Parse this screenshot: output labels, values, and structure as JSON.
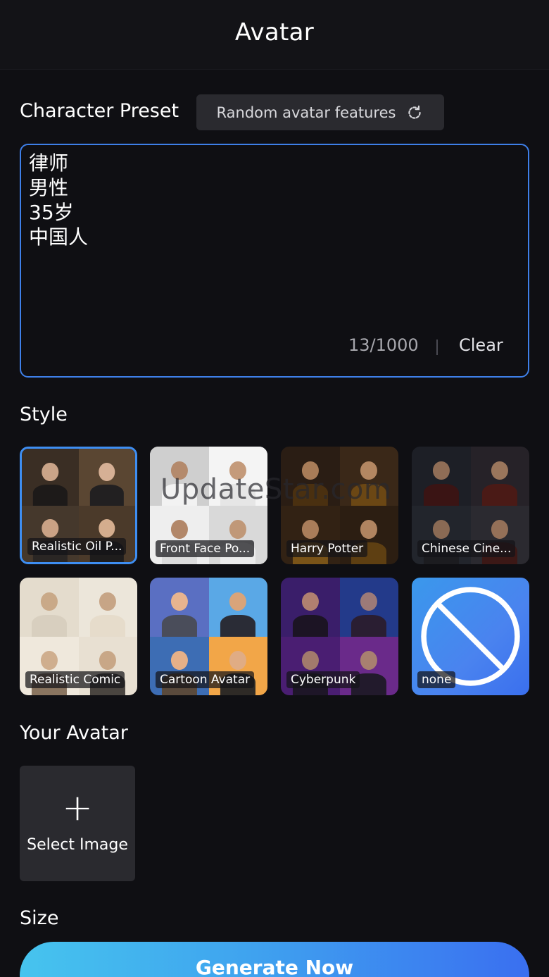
{
  "header": {
    "title": "Avatar"
  },
  "character_preset": {
    "label": "Character Preset",
    "random_button_label": "Random avatar features",
    "text": "律师\n男性\n35岁\n中国人",
    "counter": "13/1000",
    "clear_label": "Clear"
  },
  "style": {
    "label": "Style",
    "items": [
      {
        "label": "Realistic Oil P...",
        "selected": true
      },
      {
        "label": "Front Face Po..."
      },
      {
        "label": "Harry Potter"
      },
      {
        "label": "Chinese Cine..."
      },
      {
        "label": "Realistic Comic"
      },
      {
        "label": "Cartoon Avatar"
      },
      {
        "label": "Cyberpunk"
      },
      {
        "label": "none"
      }
    ]
  },
  "your_avatar": {
    "label": "Your Avatar",
    "select_image_label": "Select Image",
    "plus_glyph": "+"
  },
  "size": {
    "label": "Size"
  },
  "generate": {
    "label": "Generate Now"
  },
  "watermark": "UpdateStar.com",
  "colors": {
    "accent_blue": "#3e7fe8",
    "generate_gradient_start": "#46c4ee",
    "generate_gradient_end": "#3a6ff0",
    "background": "#0f0f13"
  }
}
